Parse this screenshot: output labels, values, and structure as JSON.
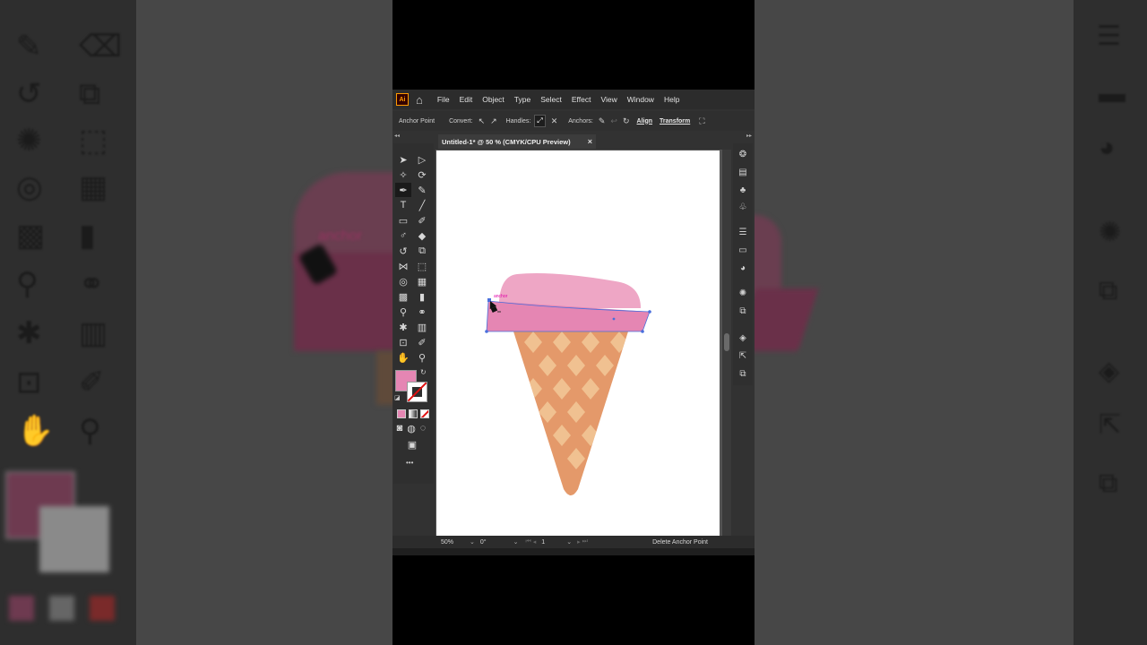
{
  "menu": [
    "File",
    "Edit",
    "Object",
    "Type",
    "Select",
    "Effect",
    "View",
    "Window",
    "Help"
  ],
  "app_logo": "Ai",
  "control_bar": {
    "tool_name": "Anchor Point",
    "convert_label": "Convert:",
    "handles_label": "Handles:",
    "anchors_label": "Anchors:",
    "align_link": "Align",
    "transform_link": "Transform"
  },
  "document_tab": {
    "title": "Untitled-1* @ 50 % (CMYK/CPU Preview)",
    "close": "×"
  },
  "canvas": {
    "smart_guide_label": "anchor",
    "background_guide_label": "anchor",
    "ice_cream_color": "#eea6c5",
    "rim_color": "#e586b3",
    "cone_color": "#e4996a",
    "cone_pattern_color": "#f3c898"
  },
  "colors": {
    "fill": "#e586b3",
    "stroke": "none",
    "selection": "#4a6fdc"
  },
  "status_bar": {
    "zoom": "50%",
    "rotation": "0°",
    "artboard_number": "1",
    "status_text": "Delete Anchor Point"
  },
  "more_tools": "•••"
}
